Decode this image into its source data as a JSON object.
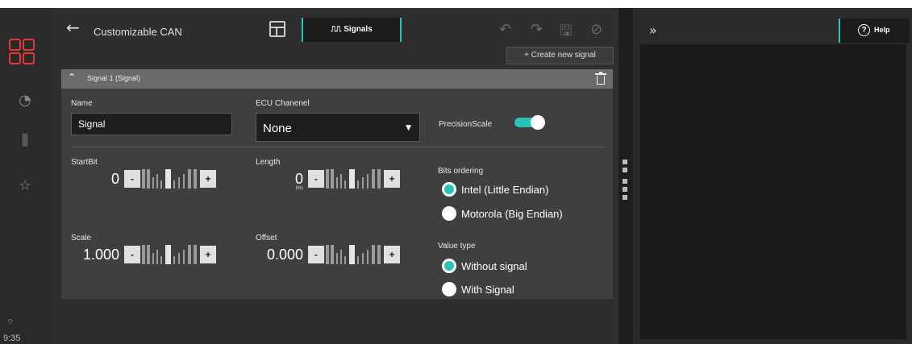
{
  "header": {
    "title": "Customizable CAN",
    "signals_tab": "Signals",
    "signals_wave": "⎍⎍",
    "create_button": "+  Create new signal"
  },
  "sidebar": {
    "time": "9:35"
  },
  "signal": {
    "title": "Signal 1 (Signal)",
    "name_label": "Name",
    "name_value": "Signal",
    "ecu_label": "ECU Chanenel",
    "ecu_value": "None",
    "precision_label": "PrecisionScale",
    "precision_on": true,
    "startbit_label": "StartBit",
    "startbit_value": "0",
    "length_label": "Length",
    "length_value": "0",
    "length_unit": "bits",
    "scale_label": "Scale",
    "scale_value": "1.000",
    "offset_label": "Offset",
    "offset_value": "0.000",
    "minus": "-",
    "plus": "+",
    "bits_ordering_label": "Bits ordering",
    "bits_ordering_options": [
      "Intel (Little Endian)",
      "Motorola (Big Endian)"
    ],
    "bits_ordering_selected": 0,
    "value_type_label": "Value type",
    "value_type_options": [
      "Without signal",
      "With Signal"
    ],
    "value_type_selected": 0
  },
  "right_panel": {
    "help_label": "Help"
  },
  "colors": {
    "accent": "#27c4b7",
    "brand": "#e53935"
  }
}
